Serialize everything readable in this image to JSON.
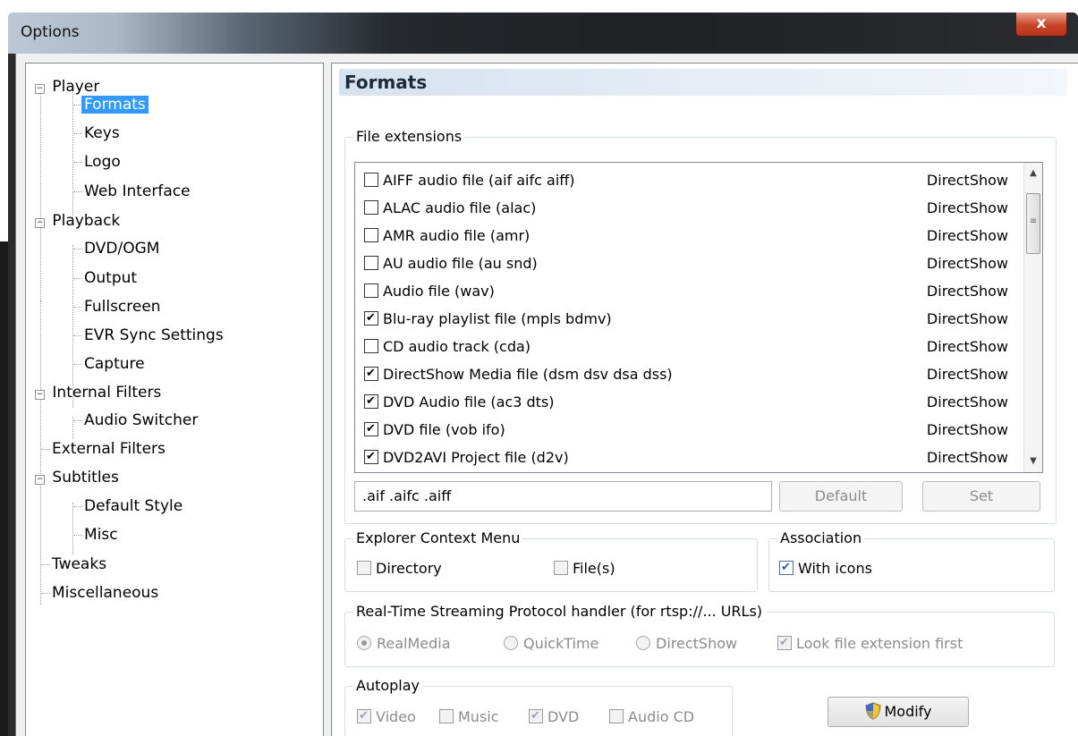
{
  "window": {
    "title": "Options",
    "close_label": "x"
  },
  "tree": {
    "items": [
      {
        "label": "Player"
      },
      {
        "label": "Formats"
      },
      {
        "label": "Keys"
      },
      {
        "label": "Logo"
      },
      {
        "label": "Web Interface"
      },
      {
        "label": "Playback"
      },
      {
        "label": "DVD/OGM"
      },
      {
        "label": "Output"
      },
      {
        "label": "Fullscreen"
      },
      {
        "label": "EVR Sync Settings"
      },
      {
        "label": "Capture"
      },
      {
        "label": "Internal Filters"
      },
      {
        "label": "Audio Switcher"
      },
      {
        "label": "External Filters"
      },
      {
        "label": "Subtitles"
      },
      {
        "label": "Default Style"
      },
      {
        "label": "Misc"
      },
      {
        "label": "Tweaks"
      },
      {
        "label": "Miscellaneous"
      }
    ],
    "selected": "Formats"
  },
  "page": {
    "title": "Formats"
  },
  "file_extensions": {
    "group_label": "File extensions",
    "rows": [
      {
        "label": "AIFF audio file (aif aifc aiff)",
        "handler": "DirectShow",
        "checked": false
      },
      {
        "label": "ALAC audio file (alac)",
        "handler": "DirectShow",
        "checked": false
      },
      {
        "label": "AMR audio file (amr)",
        "handler": "DirectShow",
        "checked": false
      },
      {
        "label": "AU audio file (au snd)",
        "handler": "DirectShow",
        "checked": false
      },
      {
        "label": "Audio file (wav)",
        "handler": "DirectShow",
        "checked": false
      },
      {
        "label": "Blu-ray playlist file (mpls bdmv)",
        "handler": "DirectShow",
        "checked": true
      },
      {
        "label": "CD audio track (cda)",
        "handler": "DirectShow",
        "checked": false
      },
      {
        "label": "DirectShow Media file (dsm dsv dsa dss)",
        "handler": "DirectShow",
        "checked": true
      },
      {
        "label": "DVD Audio file (ac3 dts)",
        "handler": "DirectShow",
        "checked": true
      },
      {
        "label": "DVD file (vob ifo)",
        "handler": "DirectShow",
        "checked": true
      },
      {
        "label": "DVD2AVI Project file (d2v)",
        "handler": "DirectShow",
        "checked": true
      }
    ],
    "extension_value": ".aif .aifc .aiff",
    "default_label": "Default",
    "set_label": "Set"
  },
  "explorer_context_menu": {
    "group_label": "Explorer Context Menu",
    "directory_label": "Directory",
    "directory_checked": false,
    "files_label": "File(s)",
    "files_checked": false
  },
  "association": {
    "group_label": "Association",
    "with_icons_label": "With icons",
    "with_icons_checked": true
  },
  "rtsp": {
    "group_label": "Real-Time Streaming Protocol handler (for rtsp://... URLs)",
    "options": [
      "RealMedia",
      "QuickTime",
      "DirectShow"
    ],
    "selected": "RealMedia",
    "look_ext_label": "Look file extension first",
    "look_ext_checked": true
  },
  "autoplay": {
    "group_label": "Autoplay",
    "video_label": "Video",
    "video_checked": true,
    "music_label": "Music",
    "music_checked": false,
    "dvd_label": "DVD",
    "dvd_checked": true,
    "audiocd_label": "Audio CD",
    "audiocd_checked": false
  },
  "modify_label": "Modify"
}
